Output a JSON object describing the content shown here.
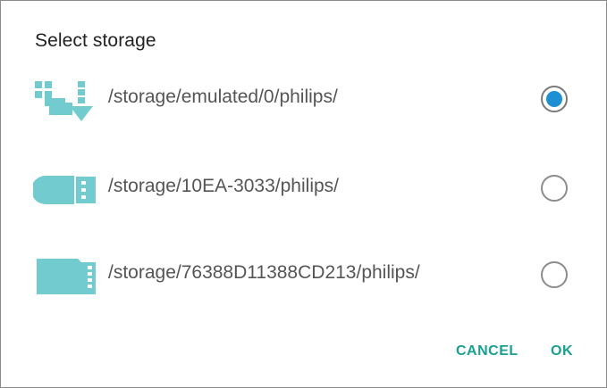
{
  "dialog": {
    "title": "Select storage",
    "options": [
      {
        "path": "/storage/emulated/0/philips/",
        "icon": "internal-storage-icon",
        "selected": true
      },
      {
        "path": "/storage/10EA-3033/philips/",
        "icon": "usb-drive-icon",
        "selected": false
      },
      {
        "path": "/storage/76388D11388CD213/philips/",
        "icon": "sd-card-icon",
        "selected": false
      }
    ],
    "buttons": {
      "cancel": "CANCEL",
      "ok": "OK"
    }
  },
  "colors": {
    "icon_teal": "#72cbce",
    "radio_selected": "#1e8fd3",
    "button_text": "#1aa092"
  }
}
